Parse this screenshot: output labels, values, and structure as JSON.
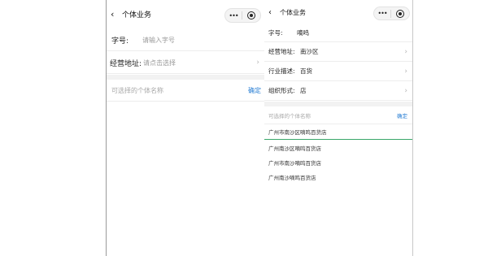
{
  "left": {
    "nav": {
      "back_icon": "‹",
      "title": "个体业务",
      "menu_dots": "•••"
    },
    "fields": [
      {
        "label": "字号:",
        "placeholder": "请输入字号"
      },
      {
        "label": "经营地址:",
        "placeholder": "请点击选择",
        "chevron": "›"
      }
    ],
    "names": {
      "hint": "可选择的个体名称",
      "confirm": "确定"
    }
  },
  "right": {
    "nav": {
      "back_icon": "‹",
      "title": "个体业务",
      "menu_dots": "•••"
    },
    "fields": [
      {
        "label": "字号:",
        "value": "嘀鸣"
      },
      {
        "label": "经营地址:",
        "value": "南沙区",
        "chevron": "›"
      },
      {
        "label": "行业描述:",
        "value": "百货",
        "chevron": "›"
      },
      {
        "label": "组织形式:",
        "value": "店",
        "chevron": "›"
      }
    ],
    "names": {
      "hint": "可选择的个体名称",
      "confirm": "确定",
      "items": [
        "广州市南沙区嘀鸣百货店",
        "广州南沙区嘀鸣百货店",
        "广州市南沙嘀鸣百货店",
        "广州南沙嘀鸣百货店"
      ]
    }
  },
  "colors": {
    "accent": "#2a7fd4",
    "selected_underline": "#3aa66a",
    "placeholder": "#9a9a9a",
    "band": "#f2f2f2"
  },
  "icons": {
    "back": "chevron-left-icon",
    "more": "more-dots-icon",
    "close": "target-icon",
    "row_arrow": "chevron-right-icon"
  }
}
